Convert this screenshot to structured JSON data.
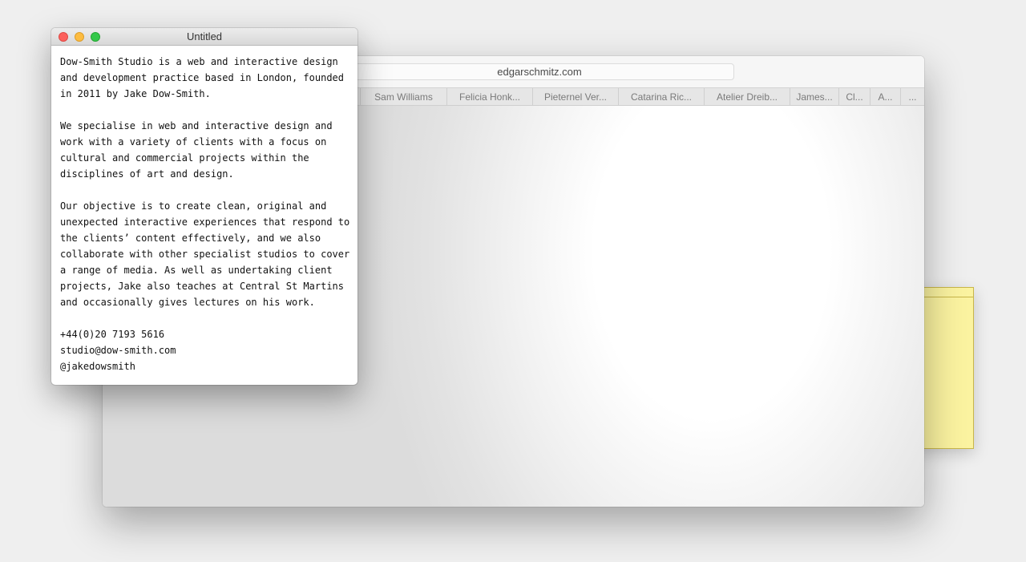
{
  "browser": {
    "url": "edgarschmitz.com",
    "tabs": [
      {
        "label": "Sam Williams"
      },
      {
        "label": "Felicia Honk..."
      },
      {
        "label": "Pieternel Ver..."
      },
      {
        "label": "Catarina Ric..."
      },
      {
        "label": "Atelier Dreib..."
      },
      {
        "label": "James..."
      },
      {
        "label": "Cl..."
      },
      {
        "label": "A..."
      },
      {
        "label": "..."
      }
    ]
  },
  "editor": {
    "title": "Untitled",
    "paragraphs": [
      [
        "Dow-Smith Studio is a web and interactive design",
        "and development practice based in London, founded",
        "in 2011 by Jake Dow-Smith."
      ],
      [
        "We specialise in web and interactive design and",
        "work with a variety of clients with a focus on",
        "cultural and commercial projects within the",
        "disciplines of art and design."
      ],
      [
        "Our objective is to create clean, original and",
        "unexpected interactive experiences that respond to",
        "the clients’ content effectively, and we also",
        "collaborate with other specialist studios to cover",
        "a range of media. As well as undertaking client",
        "projects, Jake also teaches at Central St Martins",
        "and occasionally gives lectures on his work."
      ],
      [
        "+44(0)20 7193 5616",
        "studio@dow-smith.com",
        "@jakedowsmith"
      ]
    ]
  },
  "colors": {
    "desktop": "#efefef",
    "sticky_note": "#fbf3a0",
    "close_button": "#fc605c",
    "minimize_button": "#fdbc40",
    "zoom_button": "#34c84a"
  }
}
